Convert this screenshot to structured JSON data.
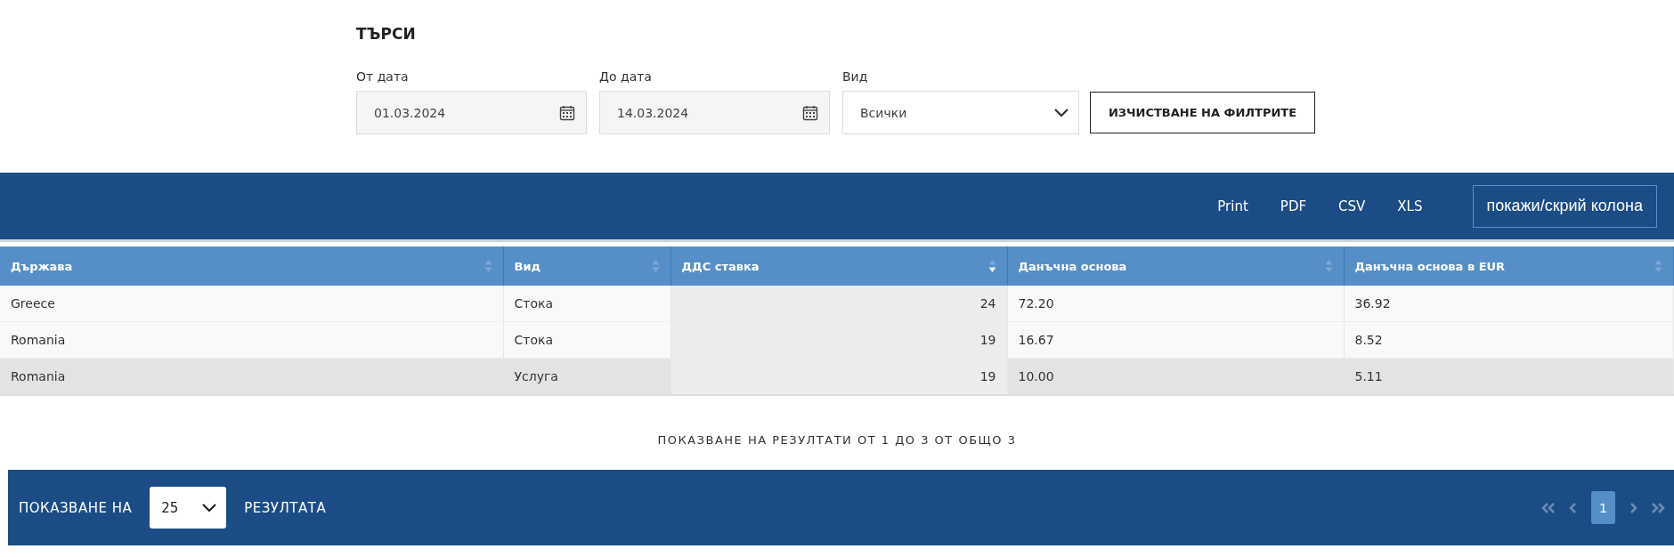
{
  "search": {
    "title": "ТЪРСИ",
    "filters": [
      {
        "kind": "date",
        "label": "От дата",
        "value": "01.03.2024"
      },
      {
        "kind": "date",
        "label": "До дата",
        "value": "14.03.2024"
      },
      {
        "kind": "select",
        "label": "Вид",
        "value": "Всички"
      }
    ],
    "clear_button": "ИЗЧИСТВАНЕ НА ФИЛТРИТЕ"
  },
  "toolbar": {
    "exports": [
      "Print",
      "PDF",
      "CSV",
      "XLS"
    ],
    "columns_button": "покажи/скрий колона"
  },
  "table": {
    "columns": [
      {
        "label": "Държава",
        "sorted_descending": false,
        "numeric": false
      },
      {
        "label": "Вид",
        "sorted_descending": false,
        "numeric": false
      },
      {
        "label": "ДДС ставка",
        "sorted_descending": true,
        "numeric": true
      },
      {
        "label": "Данъчна основа",
        "sorted_descending": false,
        "numeric": false
      },
      {
        "label": "Данъчна основа в EUR",
        "sorted_descending": false,
        "numeric": false
      }
    ],
    "rows": [
      {
        "highlighted": false,
        "cells": [
          "Greece",
          "Стока",
          "24",
          "72.20",
          "36.92"
        ]
      },
      {
        "highlighted": false,
        "cells": [
          "Romania",
          "Стока",
          "19",
          "16.67",
          "8.52"
        ]
      },
      {
        "highlighted": true,
        "cells": [
          "Romania",
          "Услуга",
          "19",
          "10.00",
          "5.11"
        ]
      }
    ]
  },
  "summary": "ПОКАЗВАНЕ НА РЕЗУЛТАТИ ОТ 1 ДО 3 ОТ ОБЩО 3",
  "footer": {
    "show_label": "ПОКАЗВАНЕ НА",
    "page_size": "25",
    "results_label": "РЕЗУЛТАТА",
    "pages": [
      {
        "label": "1",
        "selected": true
      }
    ],
    "first_disabled": true,
    "prev_disabled": true,
    "next_disabled": true,
    "last_disabled": true
  }
}
